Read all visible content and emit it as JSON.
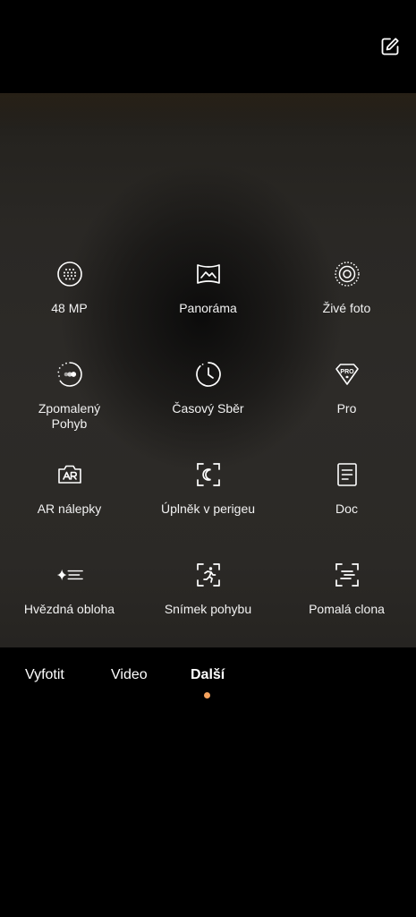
{
  "colors": {
    "accent": "#f5a25d",
    "icon": "#ffffff",
    "label": "#f2f2f2",
    "background": "#000000"
  },
  "top_bar": {
    "edit_icon": "edit-square-icon"
  },
  "modes": [
    {
      "id": "48mp",
      "label": "48 MP",
      "icon": "dot-grid-circle-icon"
    },
    {
      "id": "panorama",
      "label": "Panoráma",
      "icon": "panorama-icon"
    },
    {
      "id": "live-photo",
      "label": "Živé foto",
      "icon": "live-photo-icon"
    },
    {
      "id": "slow-motion",
      "label": "Zpomalený Pohyb",
      "icon": "slow-motion-icon"
    },
    {
      "id": "time-lapse",
      "label": "Časový Sběr",
      "icon": "clock-icon"
    },
    {
      "id": "pro",
      "label": "Pro",
      "icon": "pro-badge-icon"
    },
    {
      "id": "ar-stickers",
      "label": "AR nálepky",
      "icon": "ar-sticker-icon"
    },
    {
      "id": "supermoon",
      "label": "Úplněk v perigeu",
      "icon": "moon-frame-icon"
    },
    {
      "id": "doc",
      "label": "Doc",
      "icon": "document-icon"
    },
    {
      "id": "starry-sky",
      "label": "Hvězdná obloha",
      "icon": "sparkle-lines-icon"
    },
    {
      "id": "motion-shot",
      "label": "Snímek pohybu",
      "icon": "running-person-frame-icon"
    },
    {
      "id": "slow-shutter",
      "label": "Pomalá clona",
      "icon": "slow-shutter-frame-icon"
    }
  ],
  "tabs": [
    {
      "label": "Vyfotit",
      "active": false
    },
    {
      "label": "Video",
      "active": false
    },
    {
      "label": "Další",
      "active": true
    }
  ]
}
